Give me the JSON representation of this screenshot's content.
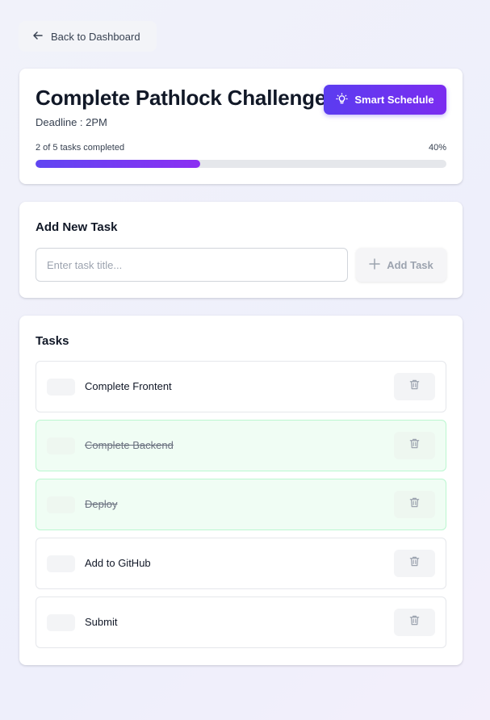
{
  "back": {
    "label": "Back to Dashboard",
    "icon": "arrow-left-icon"
  },
  "project": {
    "title": "Complete Pathlock Challenge",
    "deadline": "Deadline : 2PM",
    "smart_schedule_label": "Smart Schedule",
    "smart_schedule_icon": "lightbulb-icon",
    "progress_text": "2 of 5 tasks completed",
    "progress_percent_label": "40%",
    "progress_fraction": 0.4
  },
  "add_task": {
    "heading": "Add New Task",
    "input_placeholder": "Enter task title...",
    "input_value": "",
    "button_label": "Add Task",
    "button_icon": "plus-icon"
  },
  "tasks": {
    "heading": "Tasks",
    "items": [
      {
        "title": "Complete Frontent",
        "done": false
      },
      {
        "title": "Complete Backend",
        "done": true
      },
      {
        "title": "Deploy",
        "done": true
      },
      {
        "title": "Add to GitHub",
        "done": false
      },
      {
        "title": "Submit",
        "done": false
      }
    ],
    "delete_icon": "trash-icon"
  },
  "colors": {
    "accent": "#5b3cf0",
    "accent_end": "#7b2cf0",
    "done_bg": "#f0fdf4",
    "done_border": "#bbf7d0"
  }
}
